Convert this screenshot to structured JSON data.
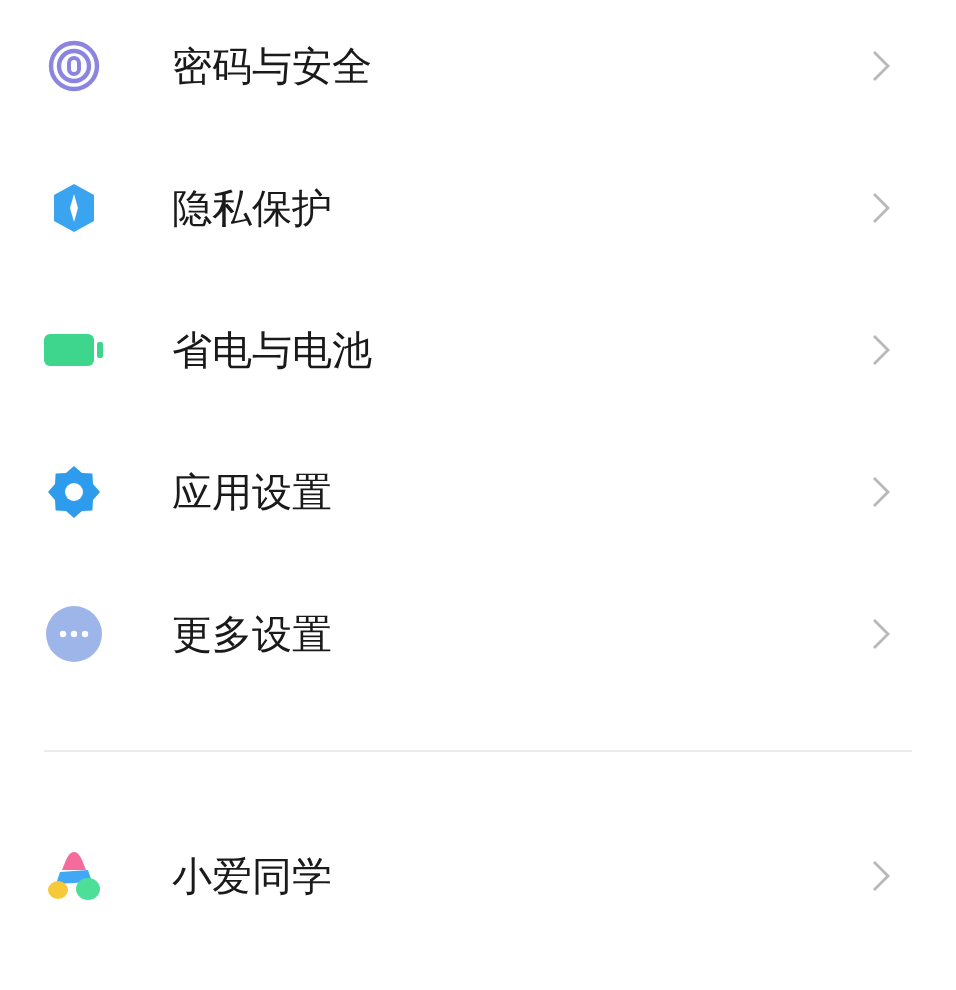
{
  "sections": [
    {
      "items": [
        {
          "kind": "fingerprint",
          "label": "密码与安全"
        },
        {
          "kind": "shield",
          "label": "隐私保护"
        },
        {
          "kind": "battery",
          "label": "省电与电池"
        },
        {
          "kind": "gear",
          "label": "应用设置"
        },
        {
          "kind": "more",
          "label": "更多设置"
        }
      ]
    },
    {
      "items": [
        {
          "kind": "assistant",
          "label": "小爱同学"
        }
      ]
    }
  ]
}
